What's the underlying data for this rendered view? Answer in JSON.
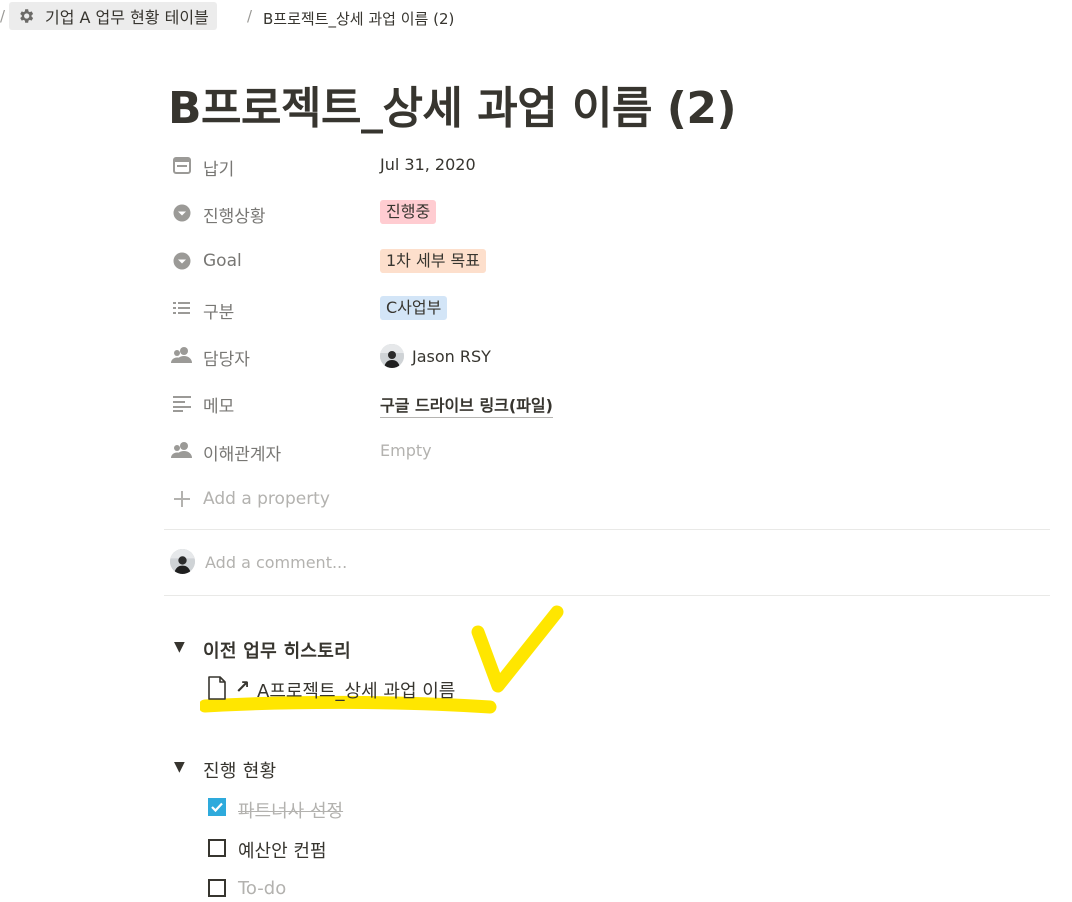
{
  "breadcrumb": {
    "separator": "/",
    "parent_label": "기업 A 업무 현황 테이블",
    "current_label": "B프로젝트_상세 과업 이름 (2)"
  },
  "page": {
    "title": "B프로젝트_상세 과업 이름 (2)"
  },
  "properties": {
    "due": {
      "label": "납기",
      "value": "Jul 31, 2020"
    },
    "status": {
      "label": "진행상황",
      "value": "진행중",
      "color": "#ffccd1"
    },
    "goal": {
      "label": "Goal",
      "value": "1차 세부 목표",
      "color": "#fddfcc"
    },
    "category": {
      "label": "구분",
      "value": "C사업부",
      "color": "#d3e5f7"
    },
    "assignee": {
      "label": "담당자",
      "value": "Jason RSY"
    },
    "memo": {
      "label": "메모",
      "value": "구글 드라이브 링크(파일)"
    },
    "stakeholder": {
      "label": "이해관계자",
      "value": "Empty"
    },
    "add_property": "Add a property"
  },
  "comment": {
    "placeholder": "Add a comment..."
  },
  "history": {
    "heading": "이전 업무 히스토리",
    "link_arrow": "↗",
    "link_label": "A프로젝트_상세 과업 이름",
    "highlight_color": "#ffe600"
  },
  "progress": {
    "heading": "진행 현황",
    "todos": [
      {
        "label": "파트너사 선정",
        "checked": true
      },
      {
        "label": "예산안 컨펌",
        "checked": false
      },
      {
        "label": "To-do",
        "checked": false,
        "placeholder": true
      }
    ]
  }
}
